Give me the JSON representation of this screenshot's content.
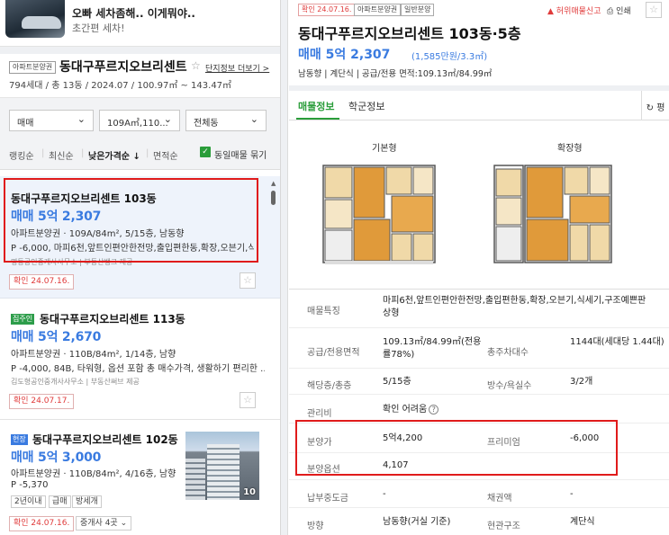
{
  "ad": {
    "title": "오빠 세차좀해.. 이게뭐야..",
    "subtitle": "초간편 세차!"
  },
  "complex": {
    "tag": "아파트분양권",
    "name": "동대구푸르지오브리센트",
    "star": "☆",
    "detail_link": "단지정보 더보기 >",
    "info": "794세대 / 총 13동 / 2024.07 / 100.97㎡ ~ 143.47㎡"
  },
  "filters": {
    "trade_type": "매매",
    "area": "109A㎡,110...",
    "dong": "전체동",
    "chevron": "⌄"
  },
  "sort": {
    "ranking": "랭킹순",
    "latest": "최신순",
    "low_price": "낮은가격순 ↓",
    "area": "면적순",
    "group_label": "동일매물 묶기"
  },
  "listings": [
    {
      "title": "동대구푸르지오브리센트 103동",
      "price": "매매 5억 2,307",
      "line1": "아파트분양권 · 109A/84m², 5/15층, 남동향",
      "line2": "P -6,000, 마피6천,앞트인편안한전망,출입편한동,확장,오븐기,식...",
      "agent": "명동공인중개사사무소 | 부동산뱅크 제공",
      "confirm": "확인 24.07.16."
    },
    {
      "badge": "집주인",
      "title": "동대구푸르지오브리센트 113동",
      "price": "매매 5억 2,670",
      "line1": "아파트분양권 · 110B/84m², 1/14층, 남향",
      "line2": "P -4,000, 84B, 타워형, 옵션 포함 총 매수가격, 생활하기 편리한 ...",
      "agent": "김도형공인중개사사무소 | 부동산써브 제공",
      "confirm": "확인 24.07.17."
    },
    {
      "badge": "현장",
      "title": "동대구푸르지오브리센트 102동",
      "price": "매매 5억 3,000",
      "line1": "아파트분양권 · 110B/84m², 4/16층, 남향",
      "line2": "P -5,370",
      "chips": [
        "2년이내",
        "급매",
        "방세개"
      ],
      "confirm": "확인 24.07.16.",
      "agents_count": "중개사 4곳 ⌄",
      "photo_count": "10"
    }
  ],
  "detail": {
    "confirm_tag": "확인 24.07.16.",
    "tag1": "아파트분양권",
    "tag2": "일반분양",
    "report": "허위매물신고",
    "print": "인쇄",
    "title": "동대구푸르지오브리센트 103동·5층",
    "price": "매매 5억 2,307",
    "price_per_area": "(1,585만원/3.3㎡)",
    "summary": "남동향 | 계단식 | 공급/전용 면적:109.13㎡/84.99㎡",
    "tab_listing": "매물정보",
    "tab_school": "학군정보",
    "unit_toggle": "평",
    "fp_basic": "기본형",
    "fp_extended": "확장형",
    "table": {
      "features_label": "매물특징",
      "features_value": "마피6천,앞트인편안한전망,출입편한동,확장,오븐기,식세기,구조예쁜판상형",
      "area_label": "공급/전용면적",
      "area_value": "109.13㎡/84.99㎡(전용률78%)",
      "parking_label": "총주차대수",
      "parking_value": "1144대(세대당 1.44대)",
      "floor_label": "해당층/총층",
      "floor_value": "5/15층",
      "rooms_label": "방수/욕실수",
      "rooms_value": "3/2개",
      "mgmt_label": "관리비",
      "mgmt_value": "확인 어려움",
      "sale_label": "분양가",
      "sale_value": "5억4,200",
      "premium_label": "프리미엄",
      "premium_value": "-6,000",
      "option_label": "분양옵션",
      "option_value": "4,107",
      "paid_label": "납부중도금",
      "paid_value": "-",
      "debt_label": "채권액",
      "debt_value": "-",
      "dir_label": "방향",
      "dir_value": "남동향(거실 기준)",
      "entry_label": "현관구조",
      "entry_value": "계단식"
    }
  }
}
